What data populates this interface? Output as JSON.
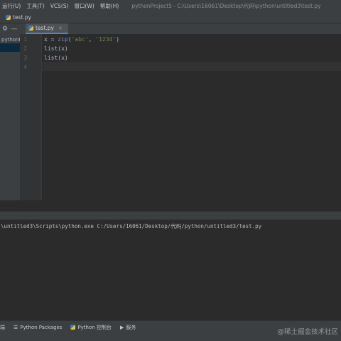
{
  "menu": {
    "items": [
      "运行(U)",
      "工具(T)",
      "VCS(S)",
      "窗口(W)",
      "帮助(H)"
    ],
    "window_title": "pythonProject5 - C:\\Users\\16061\\Desktop\\代码\\python\\untitled3\\test.py"
  },
  "breadcrumb": {
    "file": "test.py"
  },
  "editor_tab": {
    "label": "test.py"
  },
  "project_panel": {
    "label": "pythonPr"
  },
  "editor": {
    "line_numbers": [
      "1",
      "2",
      "3",
      "4"
    ],
    "lines": [
      {
        "p1": "x = ",
        "fn": "zip",
        "p2": "(",
        "s1": "'abc'",
        "p3": ", ",
        "s2": "'1234'",
        "p4": ")"
      },
      {
        "text": "list(x)"
      },
      {
        "text": "list(x)"
      },
      {
        "text": ""
      }
    ]
  },
  "console": {
    "command": "\\untitled3\\Scripts\\python.exe C:/Users/16061/Desktop/代码/python/untitled3/test.py"
  },
  "bottom_bar": {
    "items": [
      {
        "icon": "terminal-icon",
        "label": "端"
      },
      {
        "icon": "layers-icon",
        "label": "Python Packages"
      },
      {
        "icon": "python-icon",
        "label": "Python 控制台"
      },
      {
        "icon": "play-icon",
        "label": "服务"
      }
    ]
  },
  "watermark": "@稀土掘金技术社区",
  "colors": {
    "background": "#2b2b2b",
    "panel": "#3c3f41",
    "code_text": "#a9b7c6",
    "string": "#6a8759",
    "builtin": "#8888c6",
    "tab_underline": "#4a88c7"
  }
}
